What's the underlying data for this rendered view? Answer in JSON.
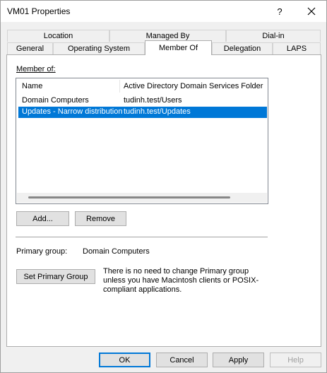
{
  "window": {
    "title": "VM01 Properties",
    "help_label": "?",
    "close_icon": "close-icon"
  },
  "tabs": {
    "row1": [
      {
        "label": "Location"
      },
      {
        "label": "Managed By"
      },
      {
        "label": "Dial-in"
      }
    ],
    "row2": [
      {
        "label": "General"
      },
      {
        "label": "Operating System"
      },
      {
        "label": "Member Of",
        "active": true
      },
      {
        "label": "Delegation"
      },
      {
        "label": "LAPS"
      }
    ]
  },
  "member_of": {
    "label": "Member of:",
    "columns": [
      "Name",
      "Active Directory Domain Services Folder"
    ],
    "rows": [
      {
        "name": "Domain Computers",
        "folder": "tudinh.test/Users",
        "selected": false
      },
      {
        "name": "Updates - Narrow distribution",
        "folder": "tudinh.test/Updates",
        "selected": true
      }
    ],
    "add_label": "Add...",
    "remove_label": "Remove"
  },
  "primary_group": {
    "label": "Primary group:",
    "value": "Domain Computers",
    "set_button_label": "Set Primary Group",
    "note": "There is no need to change Primary group unless you have Macintosh clients or POSIX-compliant applications."
  },
  "footer": {
    "ok_label": "OK",
    "cancel_label": "Cancel",
    "apply_label": "Apply",
    "help_label": "Help"
  },
  "colors": {
    "selection": "#0078d7",
    "default_button_border": "#0078d7"
  }
}
